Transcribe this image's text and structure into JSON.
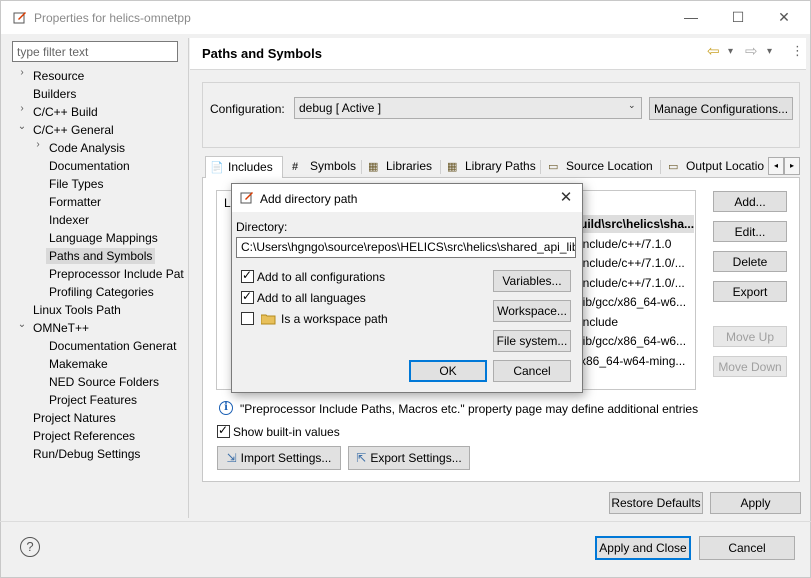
{
  "window": {
    "title": "Properties for helics-omnetpp",
    "minimize_glyph": "—",
    "maximize_glyph": "☐",
    "close_glyph": "✕"
  },
  "nav": {
    "filter_placeholder": "type filter text",
    "items": [
      {
        "label": "Resource",
        "arrow": "›",
        "level": 0
      },
      {
        "label": "Builders",
        "arrow": "",
        "level": 0
      },
      {
        "label": "C/C++ Build",
        "arrow": "›",
        "level": 0
      },
      {
        "label": "C/C++ General",
        "arrow": "⌄",
        "level": 0
      },
      {
        "label": "Code Analysis",
        "arrow": "›",
        "level": 1
      },
      {
        "label": "Documentation",
        "arrow": "",
        "level": 1
      },
      {
        "label": "File Types",
        "arrow": "",
        "level": 1
      },
      {
        "label": "Formatter",
        "arrow": "",
        "level": 1
      },
      {
        "label": "Indexer",
        "arrow": "",
        "level": 1
      },
      {
        "label": "Language Mappings",
        "arrow": "",
        "level": 1
      },
      {
        "label": "Paths and Symbols",
        "arrow": "",
        "level": 1,
        "selected": true
      },
      {
        "label": "Preprocessor Include Pat",
        "arrow": "",
        "level": 1
      },
      {
        "label": "Profiling Categories",
        "arrow": "",
        "level": 1
      },
      {
        "label": "Linux Tools Path",
        "arrow": "",
        "level": 0
      },
      {
        "label": "OMNeT++",
        "arrow": "⌄",
        "level": 0
      },
      {
        "label": "Documentation Generat",
        "arrow": "",
        "level": 1
      },
      {
        "label": "Makemake",
        "arrow": "",
        "level": 1
      },
      {
        "label": "NED Source Folders",
        "arrow": "",
        "level": 1
      },
      {
        "label": "Project Features",
        "arrow": "",
        "level": 1
      },
      {
        "label": "Project Natures",
        "arrow": "",
        "level": 0
      },
      {
        "label": "Project References",
        "arrow": "",
        "level": 0
      },
      {
        "label": "Run/Debug Settings",
        "arrow": "",
        "level": 0
      }
    ]
  },
  "header": {
    "title": "Paths and Symbols",
    "back_icon": "⇦",
    "forward_icon": "⇨",
    "menu_icon": "▾",
    "more_icon": "⋮"
  },
  "config": {
    "label": "Configuration:",
    "selected": "debug  [ Active ]",
    "manage_label": "Manage Configurations..."
  },
  "tabs": [
    {
      "label": "Includes",
      "icon": "📄"
    },
    {
      "label": "Symbols",
      "icon": "#"
    },
    {
      "label": "Libraries",
      "icon": "▦"
    },
    {
      "label": "Library Paths",
      "icon": "▦"
    },
    {
      "label": "Source Location",
      "icon": "▭"
    },
    {
      "label": "Output Locatio",
      "icon": "▭"
    }
  ],
  "includes": {
    "languages_label": "L",
    "rows": [
      "uild\\src\\helics\\sha...",
      "include/c++/7.1.0",
      "include/c++/7.1.0/...",
      "include/c++/7.1.0/...",
      "lib/gcc/x86_64-w6...",
      "include",
      "lib/gcc/x86_64-w6...",
      "x86_64-w64-ming..."
    ]
  },
  "side_buttons": {
    "add": "Add...",
    "edit": "Edit...",
    "delete": "Delete",
    "export": "Export",
    "move_up": "Move Up",
    "move_down": "Move Down"
  },
  "info_text": "\"Preprocessor Include Paths, Macros etc.\" property page may define additional entries",
  "show_builtin": {
    "label": "Show built-in values",
    "checked": true
  },
  "import_label": "Import Settings...",
  "export_label": "Export Settings...",
  "restore_defaults": "Restore Defaults",
  "apply": "Apply",
  "apply_and_close": "Apply and Close",
  "cancel": "Cancel",
  "help_glyph": "?",
  "dialog": {
    "title": "Add directory path",
    "directory_label": "Directory:",
    "directory_value": "C:\\Users\\hgngo\\source\\repos\\HELICS\\src\\helics\\shared_api_lib",
    "add_all_configs": {
      "label": "Add to all configurations",
      "checked": true
    },
    "add_all_langs": {
      "label": "Add to all languages",
      "checked": true
    },
    "workspace_path": {
      "label": "Is a workspace path",
      "checked": false
    },
    "variables": "Variables...",
    "workspace": "Workspace...",
    "file_system": "File system...",
    "ok": "OK",
    "cancel": "Cancel",
    "close_glyph": "✕"
  }
}
